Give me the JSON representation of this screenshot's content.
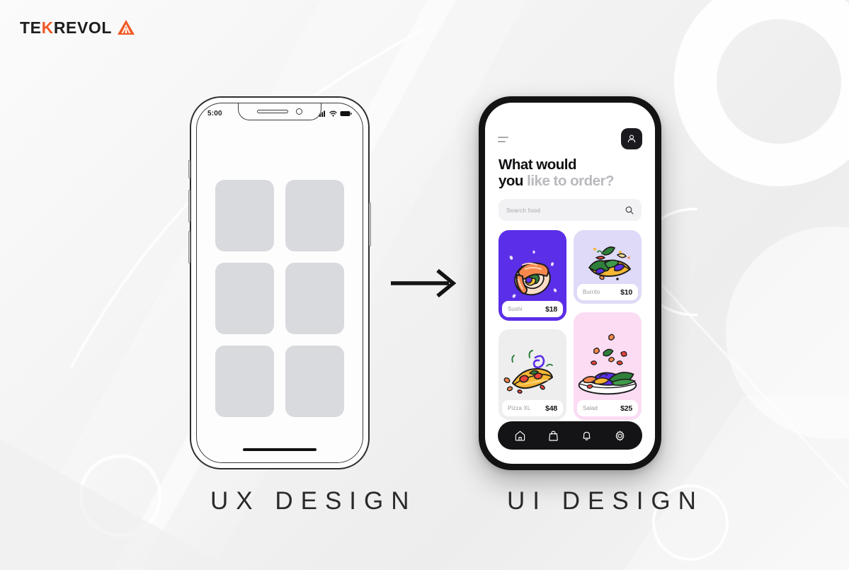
{
  "brand": {
    "name_part1": "TE",
    "name_k": "K",
    "name_part2": "REVOL",
    "mark": "triangle-logo-mark",
    "accent_color": "#f05a28",
    "text_color": "#1d1d1d"
  },
  "captions": {
    "left": "UX DESIGN",
    "right": "UI DESIGN"
  },
  "arrow": {
    "icon": "arrow-right-icon"
  },
  "ux_phone": {
    "status_bar": {
      "time": "5:00",
      "icons": [
        "signal-icon",
        "wifi-icon",
        "battery-icon"
      ]
    },
    "placeholder_count": 6,
    "placeholder_color": "#d8dade",
    "home_indicator": "home-indicator-bar",
    "side_buttons": [
      "mute-switch",
      "volume-up-button",
      "volume-down-button",
      "power-button"
    ]
  },
  "ui_phone": {
    "topbar": {
      "menu_icon": "hamburger-menu-icon",
      "avatar_icon": "user-avatar-icon",
      "avatar_bg": "#1b1b1f"
    },
    "heading": {
      "line1_bold": "What would",
      "line2_bold": "you ",
      "line2_muted": "like to order?"
    },
    "search": {
      "placeholder": "Search food",
      "icon": "search-icon",
      "background": "#f2f2f4"
    },
    "cards": [
      {
        "name": "Sushi",
        "price": "$18",
        "bg": "#5b2ee8",
        "art": "sushi-illustration"
      },
      {
        "name": "Burrito",
        "price": "$10",
        "bg": "#dedaf7",
        "art": "burrito-illustration"
      },
      {
        "name": "Pizza XL",
        "price": "$48",
        "bg": "#eeeeef",
        "art": "pizza-illustration"
      },
      {
        "name": "Salad",
        "price": "$25",
        "bg": "#fbdcf3",
        "art": "salad-illustration"
      }
    ],
    "bottom_nav": [
      {
        "icon": "home-icon",
        "active": true
      },
      {
        "icon": "bag-icon",
        "active": false
      },
      {
        "icon": "bell-icon",
        "active": false
      },
      {
        "icon": "gear-icon",
        "active": false
      }
    ],
    "nav_background": "#141417"
  }
}
